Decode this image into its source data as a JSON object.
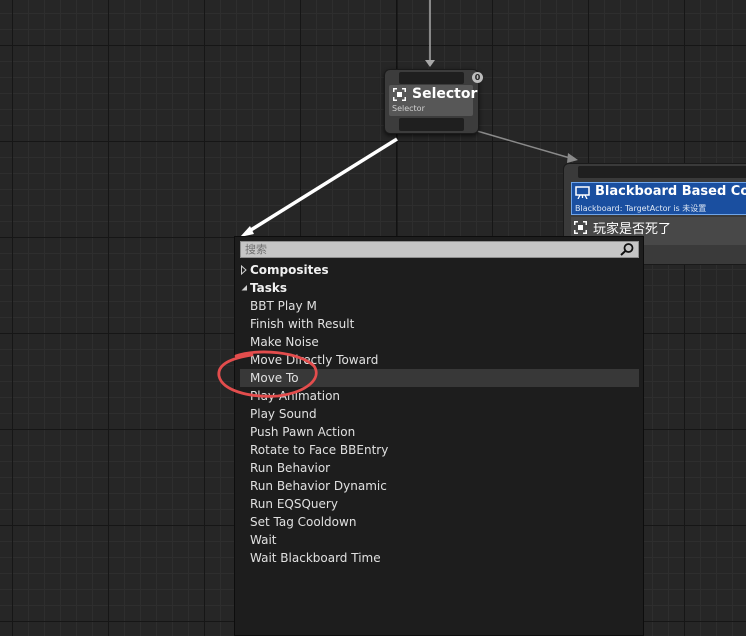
{
  "selector_node": {
    "title": "Selector",
    "subtitle": "Selector",
    "badge": "0"
  },
  "blackboard_node": {
    "title": "Blackboard Based Condition",
    "subtitle": "Blackboard: TargetActor is 未设置",
    "condition_label": "玩家是否死了"
  },
  "menu": {
    "search_placeholder": "搜索",
    "categories": [
      {
        "label": "Composites",
        "expanded": false
      },
      {
        "label": "Tasks",
        "expanded": true
      }
    ],
    "tasks": [
      "BBT Play M",
      "Finish with Result",
      "Make Noise",
      "Move Directly Toward",
      "Move To",
      "Play Animation",
      "Play Sound",
      "Push Pawn Action",
      "Rotate to Face BBEntry",
      "Run Behavior",
      "Run Behavior Dynamic",
      "Run EQSQuery",
      "Set Tag Cooldown",
      "Wait",
      "Wait Blackboard Time"
    ],
    "highlighted_task": "Move To"
  },
  "colors": {
    "canvas": "#262626",
    "blackboard_header": "#1a4fa0",
    "annotation": "#e34d4d"
  }
}
